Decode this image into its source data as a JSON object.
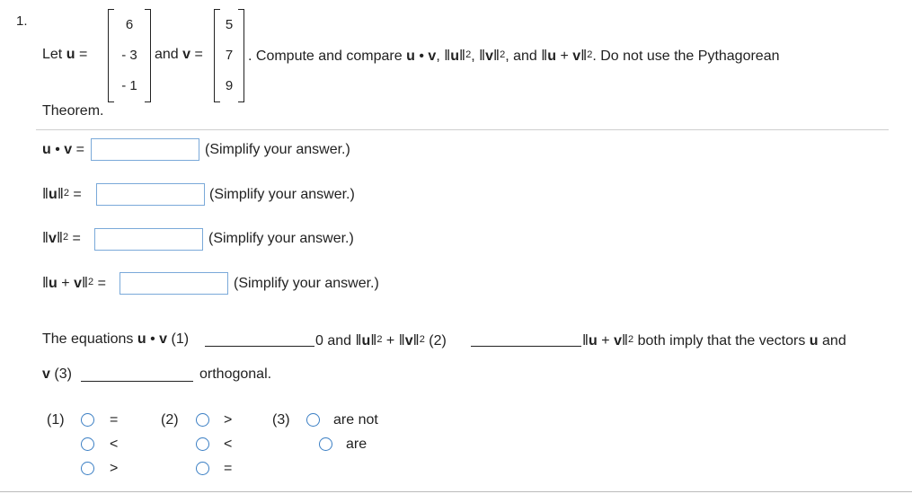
{
  "problem_number": "1.",
  "prompt": {
    "let": "Let",
    "u": "u",
    "eq": "=",
    "and": "and",
    "v": "v",
    "text1": ". Compute and compare",
    "dot": "•",
    "comma": ",",
    "norm_open": "‖",
    "norm_close": "‖",
    "sq": "2",
    "plus": "+",
    "and2": ", and",
    "text2": ". Do not use the Pythagorean",
    "line2": "Theorem."
  },
  "vector_u": [
    "6",
    "- 3",
    "- 1"
  ],
  "vector_v": [
    "5",
    "7",
    "9"
  ],
  "answers": [
    {
      "lhs_sym": "u • v =",
      "value": "",
      "hint": "(Simplify your answer.)"
    },
    {
      "lhs_sym": "=",
      "value": "",
      "hint": "(Simplify your answer.)"
    },
    {
      "lhs_sym": "=",
      "value": "",
      "hint": "(Simplify your answer.)"
    },
    {
      "lhs_sym": "=",
      "value": "",
      "hint": "(Simplify your answer.)"
    }
  ],
  "statement": {
    "part1": "The equations",
    "u": "u",
    "dot": "•",
    "v": "v",
    "blank1": "(1)",
    "zero_and": "0 and",
    "plus": "+",
    "blank2": "(2)",
    "both_imply": "both imply that the vectors",
    "and": "and",
    "blank3": "(3)",
    "orthogonal": "orthogonal."
  },
  "choice_groups": [
    {
      "label": "(1)",
      "options": [
        "=",
        "<",
        ">"
      ]
    },
    {
      "label": "(2)",
      "options": [
        ">",
        "<",
        "="
      ]
    },
    {
      "label": "(3)",
      "options": [
        "are not",
        "are"
      ]
    }
  ]
}
